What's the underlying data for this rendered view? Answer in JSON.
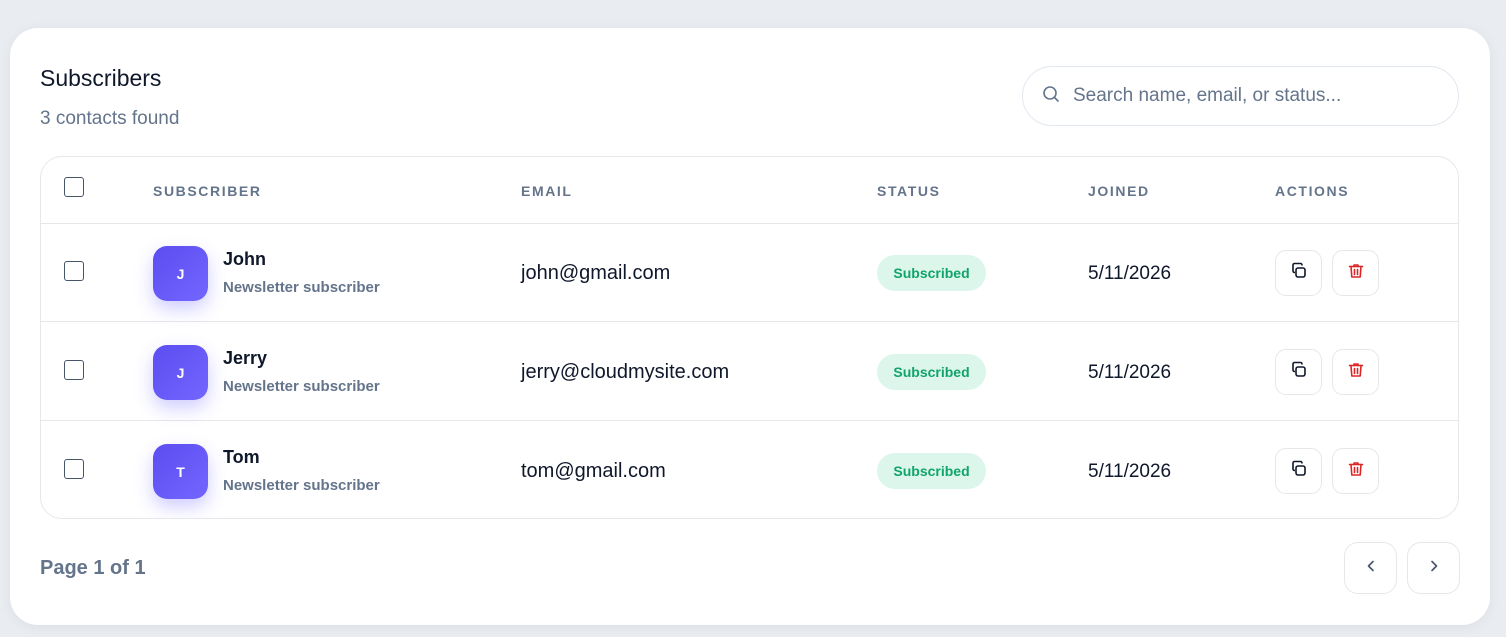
{
  "header": {
    "title": "Subscribers",
    "subtitle": "3 contacts found"
  },
  "search": {
    "placeholder": "Search name, email, or status...",
    "value": "",
    "icon": "search-icon"
  },
  "table": {
    "columns": [
      "SUBSCRIBER",
      "EMAIL",
      "STATUS",
      "JOINED",
      "ACTIONS"
    ],
    "rows": [
      {
        "initial": "J",
        "name": "John",
        "description": "Newsletter subscriber",
        "email": "john@gmail.com",
        "status": "Subscribed",
        "joined": "5/11/2026"
      },
      {
        "initial": "J",
        "name": "Jerry",
        "description": "Newsletter subscriber",
        "email": "jerry@cloudmysite.com",
        "status": "Subscribed",
        "joined": "5/11/2026"
      },
      {
        "initial": "T",
        "name": "Tom",
        "description": "Newsletter subscriber",
        "email": "tom@gmail.com",
        "status": "Subscribed",
        "joined": "5/11/2026"
      }
    ]
  },
  "pagination": {
    "label": "Page 1 of 1"
  },
  "colors": {
    "accent": "#6358ff",
    "status_bg": "#dcf6ec",
    "status_text": "#10a46b",
    "danger": "#dc2626"
  }
}
